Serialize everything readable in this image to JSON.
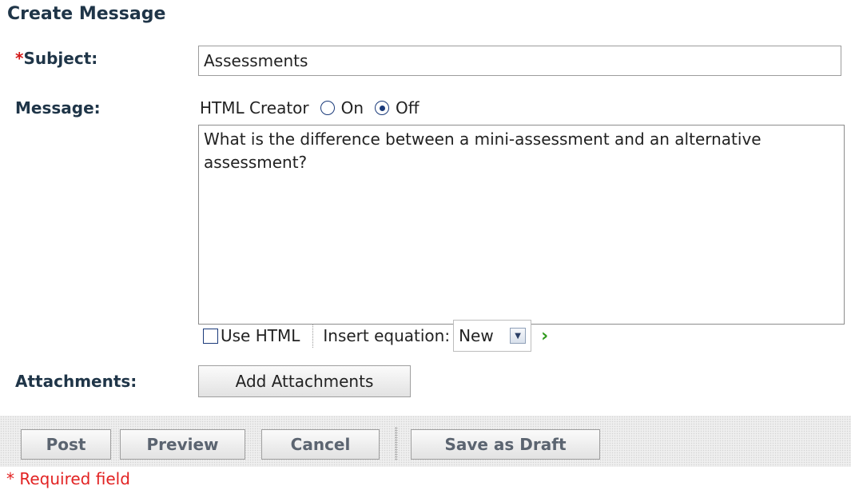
{
  "form": {
    "title": "Create Message",
    "subject": {
      "required_marker": "*",
      "label": "Subject:",
      "value": "Assessments"
    },
    "message": {
      "label": "Message:",
      "html_creator": {
        "label": "HTML Creator",
        "options": [
          "On",
          "Off"
        ],
        "selected": "Off"
      },
      "body": "What is the difference between a mini-assessment and an alternative assessment?",
      "toolbar": {
        "use_html_label": "Use HTML",
        "use_html_checked": false,
        "insert_equation_label": "Insert equation:",
        "equation_selected": "New",
        "go_icon": "green-chevron-right-icon"
      }
    },
    "attachments": {
      "label": "Attachments:",
      "button": "Add Attachments"
    },
    "actions": {
      "post": "Post",
      "preview": "Preview",
      "cancel": "Cancel",
      "save_draft": "Save as Draft"
    },
    "footer": {
      "required_note": "* Required field"
    }
  },
  "colors": {
    "label": "#1f3548",
    "required": "#e22222",
    "go": "#2f9a1d"
  }
}
